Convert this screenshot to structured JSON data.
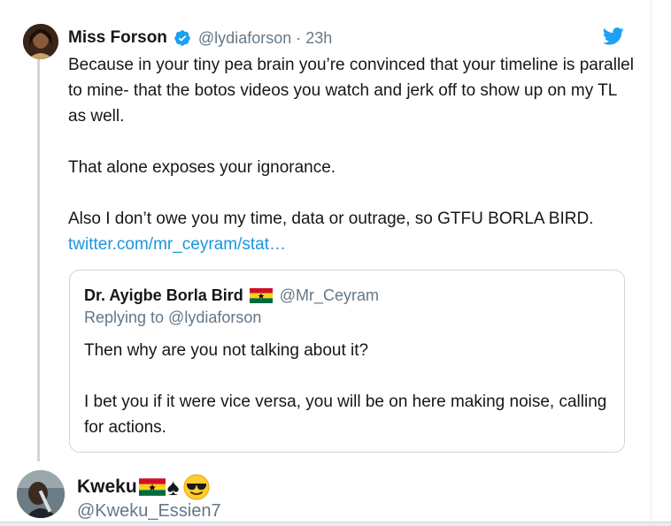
{
  "tweet": {
    "author_name": "Miss Forson",
    "author_handle": "@lydiaforson",
    "separator": "·",
    "timestamp": "23h",
    "verified_icon": "verified-badge-icon",
    "platform_icon": "twitter-bird-icon",
    "paragraphs": [
      "Because in your tiny pea brain you’re convinced that your timeline is parallel to mine- that the botos videos you watch and jerk off to show up on my TL as well.",
      "That alone exposes your ignorance.",
      "Also I don’t owe you my time, data or outrage, so GTFU BORLA BIRD."
    ],
    "link_text": "twitter.com/mr_ceyram/stat…"
  },
  "quoted_tweet": {
    "author_name": "Dr. Ayigbe Borla Bird",
    "flag_icon": "ghana-flag-icon",
    "author_handle": "@Mr_Ceyram",
    "replying_to": "Replying to @lydiaforson",
    "paragraphs": [
      "Then why are you not talking about it?",
      "I bet you if it were vice versa, you will be on here making noise, calling for actions."
    ]
  },
  "next_tweet": {
    "author_name": "Kweku",
    "emoji_icons": [
      "ghana-flag-icon",
      "spade-icon",
      "sunglasses-face-icon"
    ],
    "author_handle": "@Kweku_Essien7"
  },
  "colors": {
    "link": "#1b95e0",
    "secondary_text": "#657786",
    "border": "#ccd6dd",
    "twitter_blue": "#1da1f2"
  }
}
